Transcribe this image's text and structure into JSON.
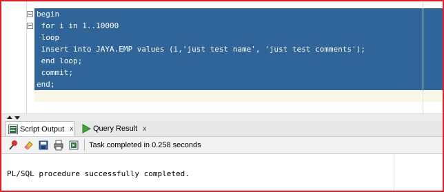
{
  "editor": {
    "code_lines": [
      "begin",
      " for i in 1..10000",
      " loop",
      " insert into JAYA.EMP values (i,'just test name', 'just test comments');",
      " end loop;",
      " commit;",
      "end;"
    ]
  },
  "tabs": [
    {
      "label": "Script Output",
      "icon": "script-output-icon",
      "close": "x"
    },
    {
      "label": "Query Result",
      "icon": "run-play-icon",
      "close": "x"
    }
  ],
  "toolbar": {
    "status": "Task completed in 0.258 seconds",
    "icons": [
      "pin-icon",
      "eraser-icon",
      "save-icon",
      "print-icon",
      "export-icon"
    ]
  },
  "output": {
    "text": "PL/SQL procedure successfully completed."
  },
  "colors": {
    "frame_border": "#e41e20",
    "selection": "#30659a",
    "current_line": "#fbf7e6",
    "play_icon": "#3aa63a"
  }
}
